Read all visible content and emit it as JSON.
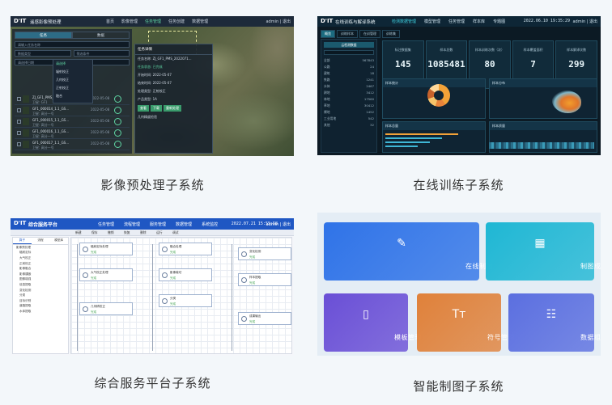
{
  "captions": {
    "imagery": "影像预处理子系统",
    "training": "在线训练子系统",
    "service": "综合服务平台子系统",
    "mapping": "智能制图子系统"
  },
  "s1": {
    "logo": "D'IT",
    "title": "遥感影像预处理",
    "nav": [
      "首页",
      "影像管理",
      "任务管理",
      "任务创建",
      "数据管理"
    ],
    "active_nav": 2,
    "user": "admin | 退出",
    "tabs": [
      "任务",
      "数据"
    ],
    "search_placeholder": "请输入任务名称",
    "filter1": "数据类型",
    "filter2": "筛选条件",
    "filter3": "请选择日期",
    "filter4": "任务类型",
    "dropdown": [
      "请选择",
      "辐射校正",
      "几何校正",
      "正射校正",
      "融合"
    ],
    "list": [
      {
        "name": "ZJ_GF1_PMS_2022...",
        "sub": "卫星: GF1",
        "date": "2022-05-08"
      },
      {
        "name": "GF1_000014_1.1_GS...",
        "sub": "卫星: 高分一号",
        "date": "2022-05-08"
      },
      {
        "name": "GF1_000015_1.1_GS...",
        "sub": "卫星: 高分一号",
        "date": "2022-05-08"
      },
      {
        "name": "GF1_000016_1.1_GS...",
        "sub": "卫星: 高分一号",
        "date": "2022-05-08"
      },
      {
        "name": "GF1_000017_1.1_GS...",
        "sub": "卫星: 高分一号",
        "date": "2022-05-08"
      }
    ],
    "detail_title": "任务详情",
    "detail_lines": [
      "任务名称: ZJ_GF1_PMS_2022071...",
      "任务状态: 已完成",
      "开始时间: 2022-05-07",
      "结束时间: 2022-05-07",
      "处理类型: 正射校正",
      "产品类型: 1A"
    ],
    "detail_buttons": [
      "查看",
      "下载",
      "重新处理"
    ],
    "detail_footer": "几何精度检验"
  },
  "s2": {
    "logo": "D'IT",
    "title": "在线训练与解译系统",
    "nav": [
      "检测数据管理",
      "模型管理",
      "任务管理",
      "样本库",
      "专题图"
    ],
    "active_nav": 0,
    "time": "2022.06.10 19:35:29",
    "user": "admin | 退出",
    "subtabs": [
      "概览",
      "训练样本",
      "在训管理",
      "训练集"
    ],
    "side_head": "云检测数据",
    "side_rows": [
      [
        "全部",
        "567843"
      ],
      [
        "公路",
        "24"
      ],
      [
        "建筑",
        "18"
      ],
      [
        "铁路",
        "1241"
      ],
      [
        "水体",
        "2467"
      ],
      [
        "耕地",
        "3412"
      ],
      [
        "林地",
        "17560"
      ],
      [
        "草地",
        "30412"
      ],
      [
        "裸地",
        "1452"
      ],
      [
        "工业用地",
        "542"
      ],
      [
        "其他",
        "32"
      ]
    ],
    "stats": [
      {
        "label": "标注数据集",
        "value": "145"
      },
      {
        "label": "样本总数",
        "value": "1085481"
      },
      {
        "label": "样本训练次数（次）",
        "value": "80"
      },
      {
        "label": "样本覆盖面积",
        "value": "7"
      },
      {
        "label": "样本解译次数",
        "value": "299"
      }
    ],
    "box_labels": [
      "样本统计",
      "样本分布",
      "样本总量",
      "样本质量"
    ]
  },
  "s3": {
    "logo": "D'IT",
    "title": "综合服务平台",
    "nav": [
      "任务管理",
      "流程管理",
      "服务管理",
      "数据管理",
      "系统监控"
    ],
    "time": "2022.07.21 15:55:58",
    "user": "admin | 退出",
    "toolbar": [
      "新建",
      "保存",
      "撤销",
      "恢复",
      "删除",
      "运行",
      "调试"
    ],
    "tree_tabs": [
      "算子",
      "流程",
      "模型库"
    ],
    "tree_nodes": [
      "影像预处理",
      "辐射定标",
      "大气校正",
      "正射校正",
      "影像融合",
      "影像镶嵌",
      "图像增强",
      "信息提取",
      "变化检测",
      "分类",
      "目标识别",
      "道路提取",
      "水体提取"
    ],
    "nodes": [
      {
        "title": "辐射定标处理",
        "status": "完成"
      },
      {
        "title": "大气校正处理",
        "status": "完成"
      },
      {
        "title": "几何精校正",
        "status": "完成"
      },
      {
        "title": "融合处理",
        "status": "完成"
      },
      {
        "title": "影像裁切",
        "status": "完成"
      },
      {
        "title": "分类",
        "status": "完成"
      },
      {
        "title": "变化检测",
        "status": "完成"
      },
      {
        "title": "样本提取",
        "status": "完成"
      },
      {
        "title": "成果输出",
        "status": "完成"
      }
    ]
  },
  "s4": {
    "tiles": [
      {
        "label": "在线制图",
        "icon": "pen-ruler-icon",
        "color": "#2f73e8"
      },
      {
        "label": "制图成果",
        "icon": "grid-icon",
        "color": "#1fb7d4"
      },
      {
        "label": "模板管理",
        "icon": "template-icon",
        "color": "#6a4fd6"
      },
      {
        "label": "符号管理",
        "icon": "text-icon",
        "color": "#e0813a"
      },
      {
        "label": "数据组织",
        "icon": "tree-icon",
        "color": "#5b6fe0"
      }
    ]
  }
}
